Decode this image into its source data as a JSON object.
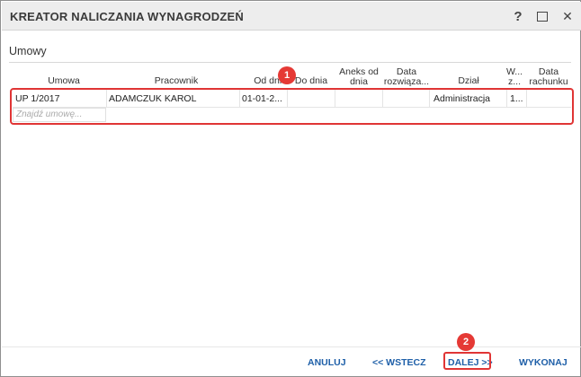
{
  "window": {
    "title": "KREATOR NALICZANIA WYNAGRODZEŃ",
    "help_label": "?",
    "close_label": "✕"
  },
  "section": {
    "label": "Umowy"
  },
  "table": {
    "columns": [
      {
        "key": "umowa",
        "lines": [
          "Umowa"
        ]
      },
      {
        "key": "pracownik",
        "lines": [
          "Pracownik"
        ]
      },
      {
        "key": "od_dnia",
        "lines": [
          "Od dnia"
        ]
      },
      {
        "key": "do_dnia",
        "lines": [
          "Do dnia"
        ]
      },
      {
        "key": "aneks",
        "lines": [
          "Aneks od",
          "dnia"
        ]
      },
      {
        "key": "data_rozw",
        "lines": [
          "Data",
          "rozwiąza..."
        ]
      },
      {
        "key": "dzial",
        "lines": [
          "Dział"
        ]
      },
      {
        "key": "w_z",
        "lines": [
          "W...",
          "z..."
        ]
      },
      {
        "key": "data_rach",
        "lines": [
          "Data",
          "rachunku"
        ]
      }
    ],
    "rows": [
      {
        "umowa": "UP 1/2017",
        "pracownik": "ADAMCZUK KAROL",
        "od_dnia": "01-01-2...",
        "do_dnia": "",
        "aneks": "",
        "data_rozw": "",
        "dzial": "Administracja",
        "w_z": "1...",
        "data_rach": ""
      }
    ],
    "filter_placeholder": "Znajdź umowę..."
  },
  "annotations": {
    "badge1": "1",
    "badge2": "2"
  },
  "footer": {
    "cancel": "ANULUJ",
    "back": "<< WSTECZ",
    "next": "DALEJ >>",
    "execute": "WYKONAJ"
  },
  "colors": {
    "highlight": "#e03535",
    "badge": "#e53935",
    "link": "#1e5fa8"
  }
}
